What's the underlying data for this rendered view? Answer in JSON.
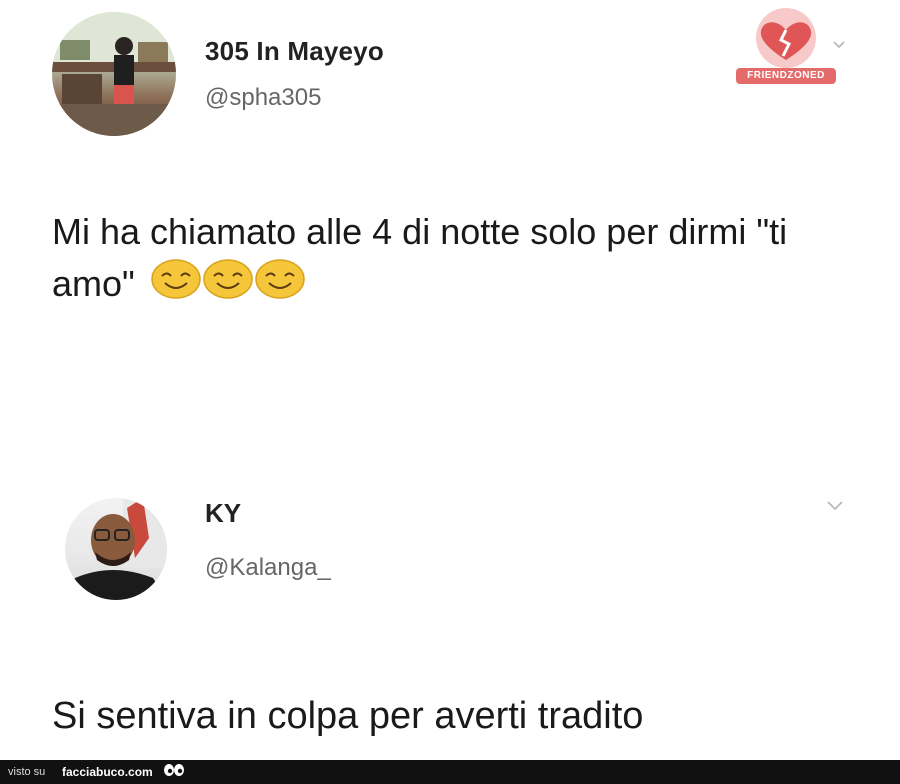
{
  "tweet": {
    "author_name": "305 In Mayeyo",
    "author_handle": "@spha305",
    "text": "Mi ha chiamato alle 4 di notte solo per dirmi \"ti amo\"",
    "emojis": [
      "smiling-face-icon",
      "smiling-face-icon",
      "smiling-face-icon"
    ]
  },
  "reply": {
    "author_name": "KY",
    "author_handle": "@Kalanga_",
    "text": "Si sentiva in colpa per averti tradito"
  },
  "watermark": {
    "badge_text": "FRIENDZONED",
    "icon": "broken-heart-icon"
  },
  "footer": {
    "prefix": "visto su",
    "site": "facciabuco.com"
  }
}
